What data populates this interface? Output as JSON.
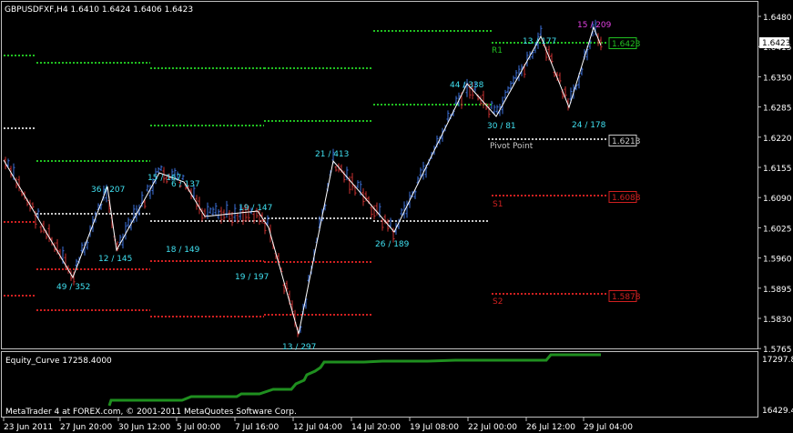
{
  "header": {
    "symbol_info": "GBPUSDFXF,H4  1.6410 1.6424 1.6406 1.6423"
  },
  "colors": {
    "bg": "#000000",
    "frame": "#c0c0c0",
    "bull": "#3b6fd8",
    "bear": "#c83030",
    "zigzag": "#ffffff",
    "label": "#40e0f0",
    "high_label": "#e040e0",
    "r1": "#21c021",
    "pivot": "#c8c8c8",
    "s_levels": "#d02020",
    "equity": "#1f8f1f"
  },
  "price_axis": {
    "ticks": [
      "1.6480",
      "1.6415",
      "1.6350",
      "1.6285",
      "1.6220",
      "1.6155",
      "1.6090",
      "1.6025",
      "1.5960",
      "1.5895",
      "1.5830",
      "1.5765"
    ],
    "current_price": "1.6423"
  },
  "time_axis": {
    "ticks": [
      "23 Jun 2011",
      "27 Jun 20:00",
      "30 Jun 12:00",
      "5 Jul 00:00",
      "7 Jul 16:00",
      "12 Jul 04:00",
      "14 Jul 20:00",
      "19 Jul 08:00",
      "22 Jul 00:00",
      "26 Jul 12:00",
      "29 Jul 04:00"
    ]
  },
  "levels": {
    "r1": {
      "label": "R1",
      "value": "1.6423"
    },
    "pivot": {
      "label": "Pivot Point",
      "value": "1.6213"
    },
    "s1": {
      "label": "S1",
      "value": "1.6088"
    },
    "s2": {
      "label": "S2",
      "value": "1.5878"
    }
  },
  "zigzag_labels": [
    "49 / 352",
    "36 / 207",
    "12 / 145",
    "15 / 167",
    "6 / 137",
    "18 / 149",
    "19 / 147",
    "19 / 197",
    "13 / 297",
    "21 / 413",
    "26 / 189",
    "44 / 338",
    "30 / 81",
    "13 / 177",
    "15 / 209",
    "24 / 178"
  ],
  "indicator": {
    "title": "Equity_Curve 17258.4000",
    "axis_top": "17297.8",
    "axis_bottom": "16429.4"
  },
  "footer": {
    "copyright": "MetaTrader 4 at FOREX.com, © 2001-2011 MetaQuotes Software Corp."
  }
}
